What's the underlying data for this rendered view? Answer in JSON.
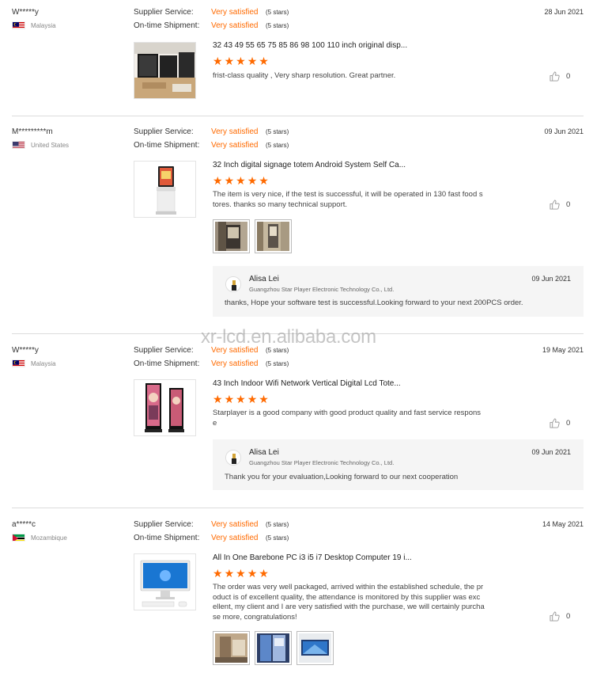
{
  "labels": {
    "supplier_service": "Supplier Service:",
    "ontime_shipment": "On-time Shipment:",
    "rating_text": "Very satisfied",
    "stars_text": "(5 stars)"
  },
  "colors": {
    "accent": "#ff6a00",
    "divider": "#dcdcdc",
    "reply_bg": "#f5f5f5"
  },
  "reviews": [
    {
      "buyer": "W*****y",
      "country": "Malaysia",
      "flag": "malaysia-flag-icon",
      "date": "28 Jun 2021",
      "product_title": "32 43 49 55 65 75 85 86 98 100 110 inch original disp...",
      "rating": 5,
      "text_lines": [
        "frist-class quality  ,    Very sharp resolution.  Great partner."
      ],
      "likes": "0"
    },
    {
      "buyer": "M*********m",
      "country": "United States",
      "flag": "usa-flag-icon",
      "date": "09 Jun 2021",
      "product_title": "32 Inch digital signage totem Android System Self Ca...",
      "rating": 5,
      "text_lines": [
        "The item is very nice, if the test is successful, it will be operated in 130 fast food s",
        "tores.  thanks so many technical support."
      ],
      "likes": "0",
      "reply": {
        "name": "Alisa Lei",
        "company": "Guangzhou Star Player Electronic Technology Co., Ltd.",
        "date": "09 Jun 2021",
        "text": "thanks,  Hope your software test is successful.Looking forward to your next 200PCS order."
      }
    },
    {
      "buyer": "W*****y",
      "country": "Malaysia",
      "flag": "malaysia-flag-icon",
      "date": "19 May 2021",
      "product_title": "43 Inch Indoor Wifi Network Vertical Digital Lcd Tote...",
      "rating": 5,
      "text_lines": [
        "Starplayer is a good company with good product quality and fast service respons",
        "e"
      ],
      "likes": "0",
      "reply": {
        "name": "Alisa Lei",
        "company": "Guangzhou Star Player Electronic Technology Co., Ltd.",
        "date": "09 Jun 2021",
        "text": "Thank you for your evaluation,Looking forward to our next cooperation"
      }
    },
    {
      "buyer": "a*****c",
      "country": "Mozambique",
      "flag": "mozambique-flag-icon",
      "date": "14 May 2021",
      "product_title": "All In One Barebone PC i3 i5 i7 Desktop Computer 19 i...",
      "rating": 5,
      "text_lines": [
        "The order was very well packaged, arrived within the established schedule, the pr",
        "oduct is of excellent quality, the attendance is monitored by this supplier was exc",
        "ellent, my client and I are very satisfied with the purchase, we will certainly purcha",
        "se more, congratulations!"
      ],
      "likes": "0"
    }
  ],
  "watermark": "xr-lcd.en.alibaba.com"
}
